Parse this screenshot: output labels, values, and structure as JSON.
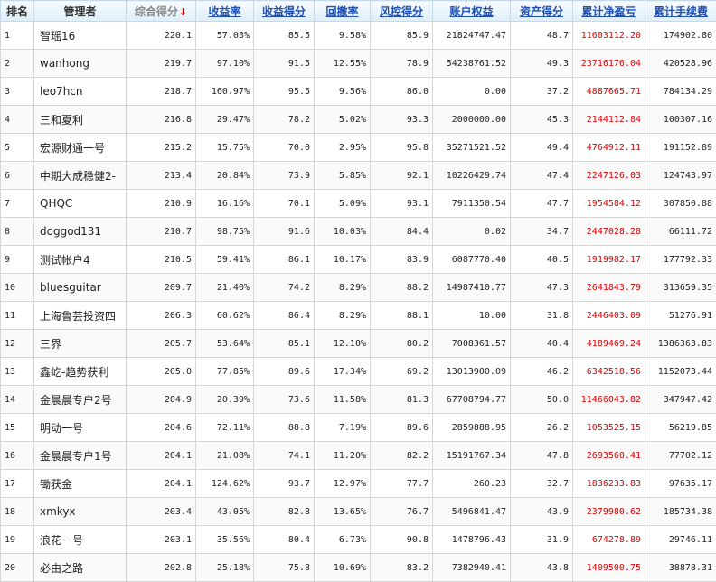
{
  "headers": [
    {
      "key": "rank",
      "label": "排名",
      "sortable": false
    },
    {
      "key": "manager",
      "label": "管理者",
      "sortable": false
    },
    {
      "key": "score",
      "label": "综合得分",
      "sortable": true,
      "current": true
    },
    {
      "key": "return",
      "label": "收益率",
      "sortable": true
    },
    {
      "key": "return_score",
      "label": "收益得分",
      "sortable": true
    },
    {
      "key": "drawdown",
      "label": "回撤率",
      "sortable": true
    },
    {
      "key": "risk_score",
      "label": "风控得分",
      "sortable": true
    },
    {
      "key": "equity",
      "label": "账户权益",
      "sortable": true
    },
    {
      "key": "asset_score",
      "label": "资产得分",
      "sortable": true
    },
    {
      "key": "net_pl",
      "label": "累计净盈亏",
      "sortable": true
    },
    {
      "key": "fees",
      "label": "累计手续费",
      "sortable": true
    }
  ],
  "sort_arrow": "↓",
  "rows": [
    [
      "1",
      "智瑶16",
      "220.1",
      "57.03%",
      "85.5",
      "9.58%",
      "85.9",
      "21824747.47",
      "48.7",
      "11603112.20",
      "174902.80"
    ],
    [
      "2",
      "wanhong",
      "219.7",
      "97.10%",
      "91.5",
      "12.55%",
      "78.9",
      "54238761.52",
      "49.3",
      "23716176.04",
      "420528.96"
    ],
    [
      "3",
      "leo7hcn",
      "218.7",
      "160.97%",
      "95.5",
      "9.56%",
      "86.0",
      "0.00",
      "37.2",
      "4887665.71",
      "784134.29"
    ],
    [
      "4",
      "三和夏利",
      "216.8",
      "29.47%",
      "78.2",
      "5.02%",
      "93.3",
      "2000000.00",
      "45.3",
      "2144112.84",
      "100307.16"
    ],
    [
      "5",
      "宏源财通一号",
      "215.2",
      "15.75%",
      "70.0",
      "2.95%",
      "95.8",
      "35271521.52",
      "49.4",
      "4764912.11",
      "191152.89"
    ],
    [
      "6",
      "中期大成稳健2-",
      "213.4",
      "20.84%",
      "73.9",
      "5.85%",
      "92.1",
      "10226429.74",
      "47.4",
      "2247126.03",
      "124743.97"
    ],
    [
      "7",
      "QHQC",
      "210.9",
      "16.16%",
      "70.1",
      "5.09%",
      "93.1",
      "7911350.54",
      "47.7",
      "1954584.12",
      "307850.88"
    ],
    [
      "8",
      "doggod131",
      "210.7",
      "98.75%",
      "91.6",
      "10.03%",
      "84.4",
      "0.02",
      "34.7",
      "2447028.28",
      "66111.72"
    ],
    [
      "9",
      "测试帐户4",
      "210.5",
      "59.41%",
      "86.1",
      "10.17%",
      "83.9",
      "6087770.40",
      "40.5",
      "1919982.17",
      "177792.33"
    ],
    [
      "10",
      "bluesguitar",
      "209.7",
      "21.40%",
      "74.2",
      "8.29%",
      "88.2",
      "14987410.77",
      "47.3",
      "2641843.79",
      "313659.35"
    ],
    [
      "11",
      "上海鲁芸投资四",
      "206.3",
      "60.62%",
      "86.4",
      "8.29%",
      "88.1",
      "10.00",
      "31.8",
      "2446403.09",
      "51276.91"
    ],
    [
      "12",
      "三界",
      "205.7",
      "53.64%",
      "85.1",
      "12.10%",
      "80.2",
      "7008361.57",
      "40.4",
      "4189469.24",
      "1386363.83"
    ],
    [
      "13",
      "鑫屹-趋势获利",
      "205.0",
      "77.85%",
      "89.6",
      "17.34%",
      "69.2",
      "13013900.09",
      "46.2",
      "6342518.56",
      "1152073.44"
    ],
    [
      "14",
      "金晨晨专户2号",
      "204.9",
      "20.39%",
      "73.6",
      "11.58%",
      "81.3",
      "67708794.77",
      "50.0",
      "11466043.82",
      "347947.42"
    ],
    [
      "15",
      "明动一号",
      "204.6",
      "72.11%",
      "88.8",
      "7.19%",
      "89.6",
      "2859888.95",
      "26.2",
      "1053525.15",
      "56219.85"
    ],
    [
      "16",
      "金晨晨专户1号",
      "204.1",
      "21.08%",
      "74.1",
      "11.20%",
      "82.2",
      "15191767.34",
      "47.8",
      "2693560.41",
      "77702.12"
    ],
    [
      "17",
      "锄获金",
      "204.1",
      "124.62%",
      "93.7",
      "12.97%",
      "77.7",
      "260.23",
      "32.7",
      "1836233.83",
      "97635.17"
    ],
    [
      "18",
      "xmkyx",
      "203.4",
      "43.05%",
      "82.8",
      "13.65%",
      "76.7",
      "5496841.47",
      "43.9",
      "2379980.62",
      "185734.38"
    ],
    [
      "19",
      "浪花一号",
      "203.1",
      "35.56%",
      "80.4",
      "6.73%",
      "90.8",
      "1478796.43",
      "31.9",
      "674278.89",
      "29746.11"
    ],
    [
      "20",
      "必由之路",
      "202.8",
      "25.18%",
      "75.8",
      "10.69%",
      "83.2",
      "7382940.41",
      "43.8",
      "1409500.75",
      "38878.31"
    ]
  ],
  "colors": {
    "header_link": "#1f4fb4",
    "net_pl_text": "#e00000",
    "sort_arrow": "#dd0000"
  }
}
